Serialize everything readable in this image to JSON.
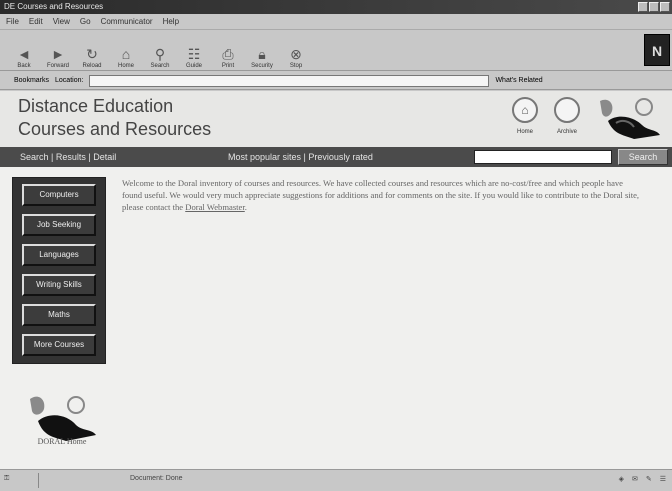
{
  "window": {
    "title": "DE Courses and Resources"
  },
  "menubar": {
    "items": [
      "File",
      "Edit",
      "View",
      "Go",
      "Communicator",
      "Help"
    ]
  },
  "toolbar": {
    "buttons": [
      "Back",
      "Forward",
      "Reload",
      "Home",
      "Search",
      "Guide",
      "Print",
      "Security",
      "Stop"
    ]
  },
  "location": {
    "bookmarks_label": "Bookmarks",
    "location_label": "Location:",
    "address": "",
    "related_label": "What's Related"
  },
  "header": {
    "title_line1": "Distance Education",
    "title_line2": "Courses and Resources",
    "home_label": "Home",
    "archive_label": "Archive"
  },
  "navband": {
    "left_text": "Search | Results | Detail",
    "right_text": "Most popular sites | Previously rated",
    "search_button": "Search"
  },
  "sidenav": {
    "items": [
      "Computers",
      "Job Seeking",
      "Languages",
      "Writing Skills",
      "Maths",
      "More Courses"
    ]
  },
  "intro": {
    "text": "Welcome to the Doral inventory of courses and resources. We have collected courses and resources which are no-cost/free and which people have found useful. We would very much appreciate suggestions for additions and for comments on the site. If you would like to contribute to the Doral site, please contact the ",
    "link": "Doral Webmaster",
    "after": "."
  },
  "footer": {
    "label": "DORAL Home"
  },
  "status": {
    "left": "Document: Done",
    "doc": "Document: Done"
  },
  "colors": {
    "navband": "#4b4b4b",
    "sidenav": "#333333",
    "page": "#f0f0ee"
  }
}
